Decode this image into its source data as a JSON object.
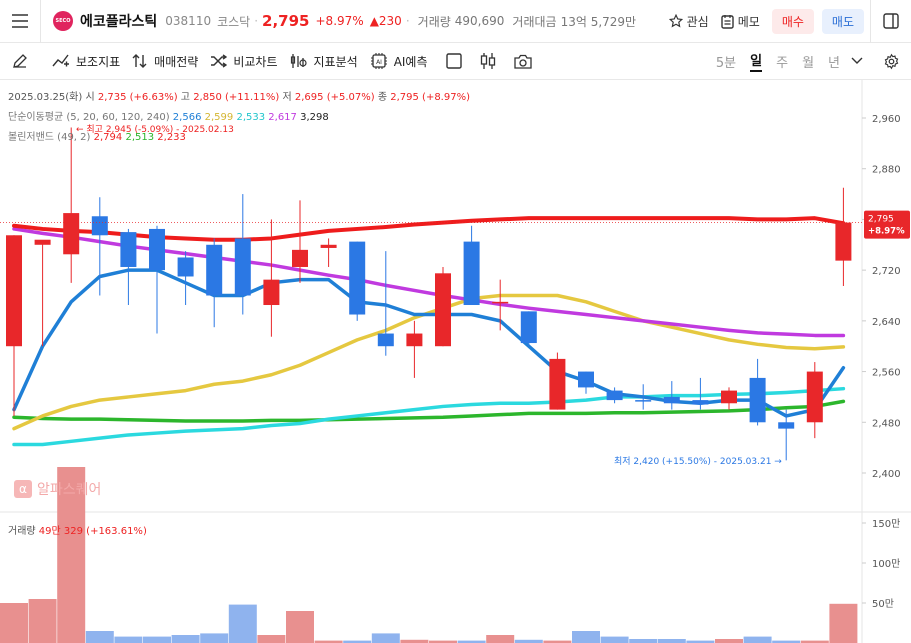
{
  "header": {
    "logo_text": "SECO",
    "name": "에코플라스틱",
    "code": "038110",
    "market": "코스닥",
    "price": "2,795",
    "change_pct": "+8.97%",
    "change_abs": "▲230",
    "volume_label": "거래량",
    "volume_value": "490,690",
    "amount_label": "거래대금",
    "amount_value": "13억 5,729만",
    "watch_label": "관심",
    "memo_label": "메모",
    "buy_label": "매수",
    "sell_label": "매도"
  },
  "toolbar": {
    "indicator_label": "보조지표",
    "strategy_label": "매매전략",
    "compare_label": "비교차트",
    "analysis_label": "지표분석",
    "ai_label": "AI예측",
    "periods": [
      "5분",
      "일",
      "주",
      "월",
      "년"
    ],
    "active_period": "일"
  },
  "legend": {
    "ohlc_date": "2025.03.25(화)",
    "open_label": "시",
    "open_value": "2,735 (+6.63%)",
    "high_label": "고",
    "high_value": "2,850 (+11.11%)",
    "low_label": "저",
    "low_value": "2,695 (+5.07%)",
    "close_label": "종",
    "close_value": "2,795 (+8.97%)",
    "ma_label": "단순이동평균 (5, 20, 60, 120, 240)",
    "ma_values": [
      "2,566",
      "2,599",
      "2,533",
      "2,617",
      "3,298"
    ],
    "bb_label": "볼린저밴드 (49, 2)",
    "bb_values": [
      "2,794",
      "2,513",
      "2,233"
    ],
    "volume_label": "거래량",
    "volume_value": "49만 329 (+163.61%)"
  },
  "annotations": {
    "high_note": "← 최고 2,945 (-5.09%) - 2025.02.13",
    "low_note": "최저 2,420 (+15.50%) - 2025.03.21 →",
    "price_tag": "2,795",
    "pct_tag": "+8.97%"
  },
  "watermark": "알파스퀘어",
  "colors": {
    "up": "#e8272a",
    "down": "#2b78e4",
    "ma5": "#1f7fd6",
    "ma20": "#e5c840",
    "ma60": "#2bd9df",
    "ma120": "#c03adf",
    "bb_upper": "#ee1c1c",
    "bb_mid": "#2cb62c"
  },
  "chart_data": {
    "type": "candlestick",
    "y_ticks": [
      2400,
      2480,
      2560,
      2640,
      2720,
      2800,
      2880,
      2960
    ],
    "y_tick_labels": [
      "2,400",
      "2,480",
      "2,560",
      "2,640",
      "2,720",
      "2,800",
      "2,880",
      "2,960"
    ],
    "vol_ticks": [
      "50만",
      "100만",
      "150만"
    ],
    "candles": [
      {
        "o": 2600,
        "c": 2775,
        "h": 2775,
        "l": 2490
      },
      {
        "o": 2760,
        "c": 2768,
        "h": 2765,
        "l": 2600
      },
      {
        "o": 2745,
        "c": 2810,
        "h": 2945,
        "l": 2700
      },
      {
        "o": 2805,
        "c": 2775,
        "h": 2835,
        "l": 2680
      },
      {
        "o": 2780,
        "c": 2725,
        "h": 2785,
        "l": 2665
      },
      {
        "o": 2785,
        "c": 2720,
        "h": 2790,
        "l": 2620
      },
      {
        "o": 2740,
        "c": 2710,
        "h": 2750,
        "l": 2665
      },
      {
        "o": 2760,
        "c": 2680,
        "h": 2770,
        "l": 2630
      },
      {
        "o": 2770,
        "c": 2680,
        "h": 2840,
        "l": 2650
      },
      {
        "o": 2665,
        "c": 2705,
        "h": 2800,
        "l": 2615
      },
      {
        "o": 2725,
        "c": 2752,
        "h": 2830,
        "l": 2700
      },
      {
        "o": 2755,
        "c": 2760,
        "h": 2770,
        "l": 2725
      },
      {
        "o": 2765,
        "c": 2650,
        "h": 2765,
        "l": 2640
      },
      {
        "o": 2620,
        "c": 2600,
        "h": 2750,
        "l": 2585
      },
      {
        "o": 2600,
        "c": 2620,
        "h": 2640,
        "l": 2550
      },
      {
        "o": 2600,
        "c": 2715,
        "h": 2725,
        "l": 2600
      },
      {
        "o": 2765,
        "c": 2665,
        "h": 2790,
        "l": 2665
      },
      {
        "o": 2670,
        "c": 2670,
        "h": 2705,
        "l": 2625
      },
      {
        "o": 2655,
        "c": 2605,
        "h": 2655,
        "l": 2600
      },
      {
        "o": 2500,
        "c": 2580,
        "h": 2590,
        "l": 2500
      },
      {
        "o": 2560,
        "c": 2535,
        "h": 2560,
        "l": 2525
      },
      {
        "o": 2530,
        "c": 2515,
        "h": 2535,
        "l": 2510
      },
      {
        "o": 2515,
        "c": 2514,
        "h": 2540,
        "l": 2500
      },
      {
        "o": 2520,
        "c": 2510,
        "h": 2545,
        "l": 2500
      },
      {
        "o": 2515,
        "c": 2508,
        "h": 2550,
        "l": 2500
      },
      {
        "o": 2510,
        "c": 2530,
        "h": 2535,
        "l": 2500
      },
      {
        "o": 2550,
        "c": 2480,
        "h": 2580,
        "l": 2475
      },
      {
        "o": 2480,
        "c": 2470,
        "h": 2500,
        "l": 2420
      },
      {
        "o": 2480,
        "c": 2560,
        "h": 2575,
        "l": 2455
      },
      {
        "o": 2735,
        "c": 2795,
        "h": 2850,
        "l": 2695
      }
    ],
    "ma5": [
      2500,
      2600,
      2670,
      2710,
      2720,
      2720,
      2700,
      2680,
      2680,
      2700,
      2705,
      2705,
      2670,
      2665,
      2650,
      2650,
      2650,
      2640,
      2600,
      2560,
      2545,
      2525,
      2520,
      2513,
      2510,
      2515,
      2515,
      2490,
      2500,
      2566
    ],
    "ma20": [
      2470,
      2490,
      2505,
      2515,
      2520,
      2525,
      2530,
      2540,
      2545,
      2555,
      2570,
      2590,
      2610,
      2625,
      2645,
      2660,
      2675,
      2680,
      2680,
      2680,
      2670,
      2655,
      2640,
      2630,
      2620,
      2610,
      2603,
      2598,
      2596,
      2599
    ],
    "ma60": [
      2445,
      2445,
      2450,
      2455,
      2460,
      2463,
      2466,
      2468,
      2470,
      2475,
      2478,
      2485,
      2490,
      2495,
      2500,
      2505,
      2508,
      2510,
      2510,
      2512,
      2515,
      2520,
      2520,
      2522,
      2522,
      2524,
      2525,
      2527,
      2530,
      2533
    ],
    "ma120": [
      2785,
      2778,
      2772,
      2765,
      2758,
      2752,
      2746,
      2740,
      2734,
      2728,
      2720,
      2712,
      2705,
      2696,
      2688,
      2680,
      2673,
      2666,
      2660,
      2655,
      2650,
      2645,
      2640,
      2635,
      2630,
      2625,
      2621,
      2619,
      2617,
      2617
    ],
    "bb_upper": [
      2790,
      2785,
      2782,
      2780,
      2776,
      2772,
      2770,
      2768,
      2768,
      2770,
      2776,
      2782,
      2785,
      2788,
      2792,
      2795,
      2798,
      2800,
      2802,
      2802,
      2802,
      2802,
      2802,
      2802,
      2802,
      2802,
      2800,
      2800,
      2802,
      2794
    ],
    "bb_mid": [
      2488,
      2486,
      2485,
      2485,
      2484,
      2483,
      2482,
      2482,
      2482,
      2483,
      2483,
      2484,
      2485,
      2486,
      2487,
      2488,
      2490,
      2492,
      2494,
      2494,
      2494,
      2495,
      2495,
      2496,
      2497,
      2498,
      2500,
      2503,
      2505,
      2513
    ],
    "volumes": [
      5,
      5.5,
      22,
      1.5,
      0.8,
      0.8,
      1,
      1.2,
      4.8,
      1,
      4,
      0.3,
      0.3,
      1.2,
      0.4,
      0.3,
      0.3,
      1,
      0.4,
      0.3,
      1.5,
      0.8,
      0.5,
      0.5,
      0.3,
      0.5,
      0.8,
      0.3,
      0.3,
      4.9
    ],
    "vol_max": 15
  }
}
